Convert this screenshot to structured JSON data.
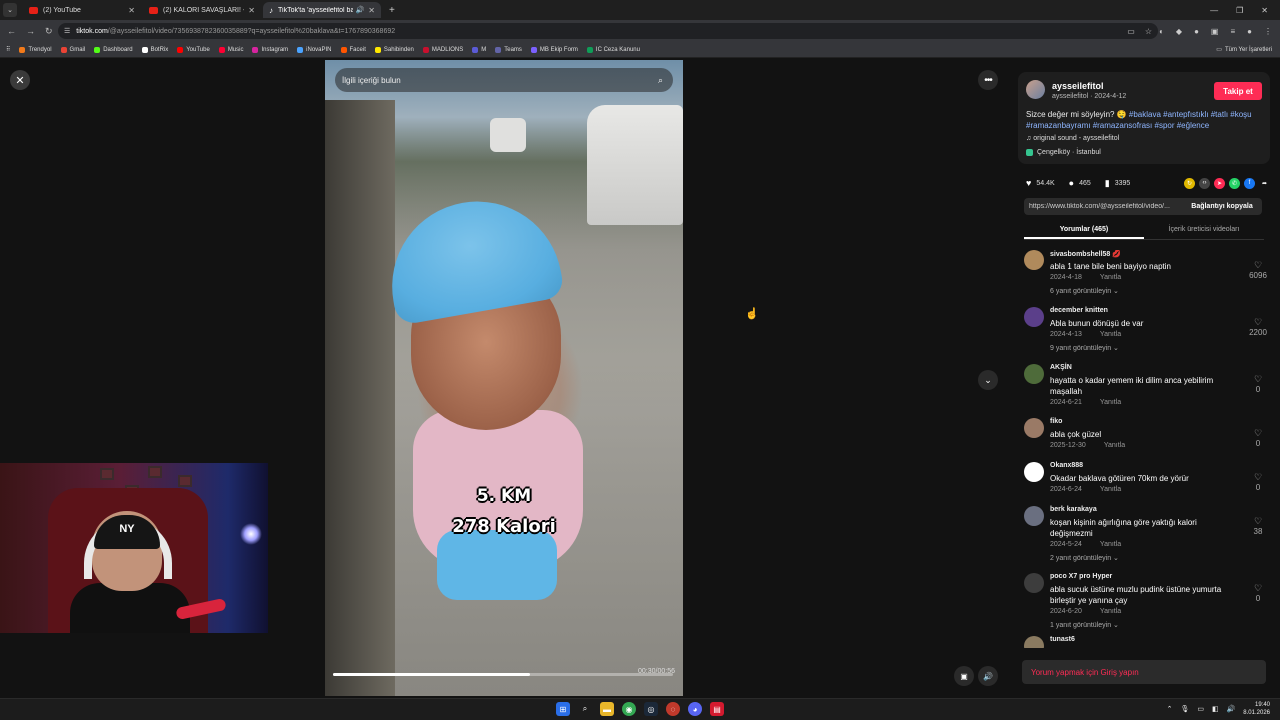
{
  "browser": {
    "tabs": [
      {
        "title": "(2) YouTube",
        "active": false
      },
      {
        "title": "(2) KALORİ SAVAŞLARI! - YouTu",
        "active": false
      },
      {
        "title": "TikTok'ta 'aysseilefitol bakla",
        "active": true
      }
    ],
    "url_host": "tiktok.com",
    "url_path": "/@aysseilefitol/video/7356938782360035889?q=aysseilefitol%20baklava&t=1767890368692",
    "bookmarks": [
      "Trendyol",
      "Gmail",
      "Dashboard",
      "BotRix",
      "YouTube",
      "Music",
      "Instagram",
      "iNovaPIN",
      "Faceit",
      "Sahibinden",
      "MADLIONS",
      "M",
      "Teams",
      "MB Ekip Form",
      "IC Ceza Kanunu"
    ],
    "bookmarks_right": "Tüm Yer İşaretleri"
  },
  "video": {
    "search_placeholder": "İlgili içeriği bulun",
    "overlay_line1": "5. KM",
    "overlay_line2": "278 Kalori",
    "time": "00:30/00:56",
    "progress_fraction": 0.58
  },
  "post": {
    "username": "aysseilefitol",
    "handle_date": "aysseilefitol · 2024-4-12",
    "follow_label": "Takip et",
    "caption_text": "Sizce değer mi söyleyin? 🤤 ",
    "caption_tags": "#baklava #antepfıstıklı #tatlı #koşu #ramazanbayramı #ramazansofrası #spor #eğlence",
    "sound": "original sound - aysseilefitol",
    "location": "Çengelköy · İstanbul",
    "likes": "54.4K",
    "comments_count": "465",
    "saves": "3395",
    "link_url": "https://www.tiktok.com/@aysseilefitol/video/...",
    "copy_label": "Bağlantıyı kopyala",
    "tab_comments": "Yorumlar (465)",
    "tab_creator": "İçerik üreticisi videoları",
    "comment_placeholder": "Yorum yapmak için Giriş yapın"
  },
  "comments": [
    {
      "user": "sivasbombshell58 💋",
      "text": "abla 1 tane bile beni bayiyo naptin",
      "date": "2024-4-18",
      "reply": "Yanıtla",
      "likes": "6096",
      "more": "6 yanıt görüntüleyin ⌄",
      "avatar": "#b08a5c"
    },
    {
      "user": "december knitten",
      "text": "Abla bunun dönüşü de var",
      "date": "2024-4-13",
      "reply": "Yanıtla",
      "likes": "2200",
      "more": "9 yanıt görüntüleyin ⌄",
      "avatar": "#5b3f8a"
    },
    {
      "user": "AKŞİN",
      "text": "hayatta o kadar yemem iki dilim anca yebilirim maşallah",
      "date": "2024-6-21",
      "reply": "Yanıtla",
      "likes": "0",
      "more": "",
      "avatar": "#4e6b3a"
    },
    {
      "user": "fiko",
      "text": "abla çok güzel",
      "date": "2025-12-30",
      "reply": "Yanıtla",
      "likes": "0",
      "more": "",
      "avatar": "#9a7a66"
    },
    {
      "user": "Okanx888",
      "text": "Okadar baklava götüren 70km de yörür",
      "date": "2024-6-24",
      "reply": "Yanıtla",
      "likes": "0",
      "more": "",
      "avatar": "#ffffff"
    },
    {
      "user": "berk karakaya",
      "text": "koşan kişinin ağırlığına göre yaktığı kalori değişmezmi",
      "date": "2024-5-24",
      "reply": "Yanıtla",
      "likes": "38",
      "more": "2 yanıt görüntüleyin ⌄",
      "avatar": "#6a6f80"
    },
    {
      "user": "poco X7 pro Hyper",
      "text": "abla sucuk üstüne muzlu pudink üstüne yumurta birleştir ye yanına çay",
      "date": "2024-6-20",
      "reply": "Yanıtla",
      "likes": "0",
      "more": "1 yanıt görüntüleyin ⌄",
      "avatar": "#3d3d3d"
    },
    {
      "user": "tunast6",
      "text": "",
      "date": "",
      "reply": "",
      "likes": "",
      "more": "",
      "avatar": "#8a7a60"
    }
  ],
  "taskbar": {
    "time": "19:40",
    "date": "8.01.2026"
  }
}
